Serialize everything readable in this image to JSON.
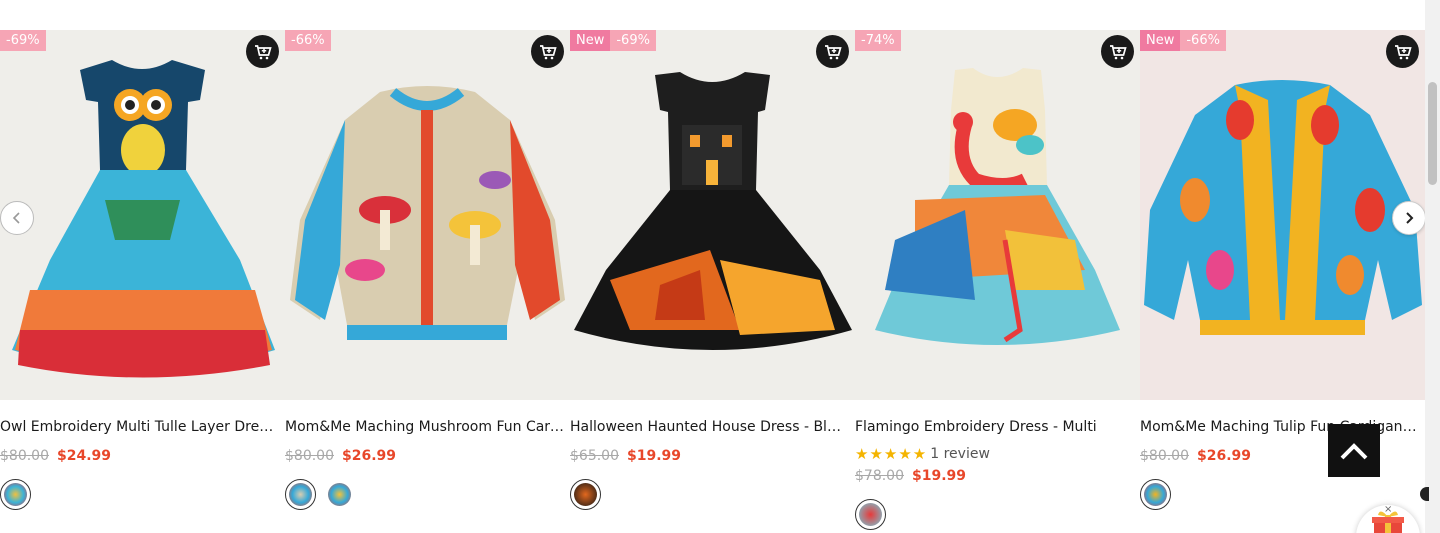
{
  "carousel": {
    "products": [
      {
        "badges": [
          {
            "type": "sale",
            "text": "-69%"
          }
        ],
        "title": "Owl Embroidery Multi Tulle Layer Dress - Multi",
        "old_price": "$80.00",
        "price": "$24.99",
        "swatch_count": 1
      },
      {
        "badges": [
          {
            "type": "sale",
            "text": "-66%"
          }
        ],
        "title": "Mom&Me Maching Mushroom Fun Cardigan - Multi",
        "old_price": "$80.00",
        "price": "$26.99",
        "swatch_count": 2
      },
      {
        "badges": [
          {
            "type": "new",
            "text": "New"
          },
          {
            "type": "sale",
            "text": "-69%"
          }
        ],
        "title": "Halloween Haunted House Dress - Black",
        "old_price": "$65.00",
        "price": "$19.99",
        "swatch_count": 1
      },
      {
        "badges": [
          {
            "type": "sale",
            "text": "-74%"
          }
        ],
        "title": "Flamingo Embroidery Dress - Multi",
        "rating_stars": 5,
        "rating_text": "1 review",
        "old_price": "$78.00",
        "price": "$19.99",
        "swatch_count": 1
      },
      {
        "badges": [
          {
            "type": "new",
            "text": "New"
          },
          {
            "type": "sale",
            "text": "-66%"
          }
        ],
        "title": "Mom&Me Maching Tulip Fun Cardigan - Multi",
        "old_price": "$80.00",
        "price": "$26.99",
        "swatch_count": 1
      }
    ],
    "icons": {
      "cart": "cart-plus-icon",
      "prev": "chevron-left-icon",
      "next": "chevron-right-icon",
      "back_to_top": "chevron-up-icon",
      "gift": "gift-icon",
      "close": "close-icon"
    },
    "gift_close_glyph": "×"
  },
  "colors": {
    "badge_new": "#f07aa0",
    "badge_sale": "#f6a5b5",
    "sale_price": "#e8472a",
    "old_price": "#a8a8a8",
    "stars": "#f4b400",
    "cart_button": "#1a1a1a",
    "back_to_top": "#111111"
  }
}
